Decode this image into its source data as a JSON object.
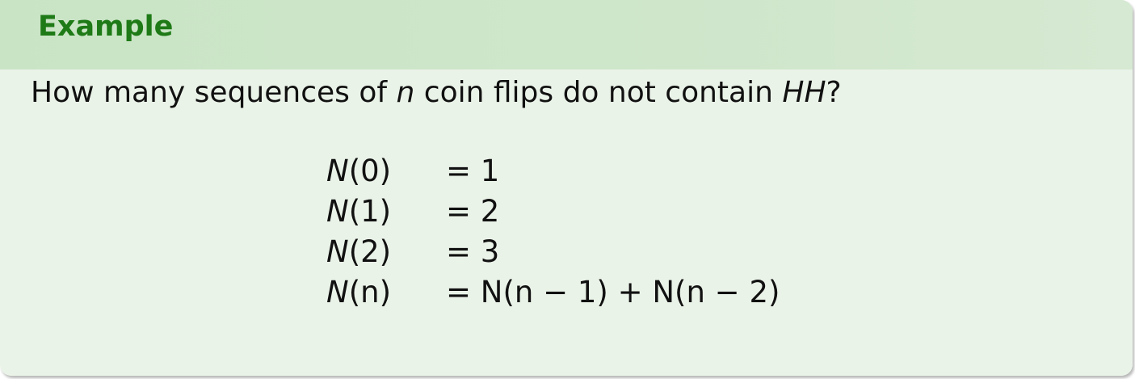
{
  "block": {
    "title": "Example"
  },
  "question": {
    "prefix": "How many sequences of ",
    "var_n": "n",
    "middle": " coin flips do not contain ",
    "pattern": "HH",
    "suffix": "?"
  },
  "equations": [
    {
      "lhs_func": "N",
      "lhs_arg": "(0)",
      "rhs": "= 1"
    },
    {
      "lhs_func": "N",
      "lhs_arg": "(1)",
      "rhs": "= 2"
    },
    {
      "lhs_func": "N",
      "lhs_arg": "(2)",
      "rhs": "= 3"
    },
    {
      "lhs_func": "N",
      "lhs_arg": "(n)",
      "rhs": "= N(n − 1) + N(n − 2)"
    }
  ]
}
